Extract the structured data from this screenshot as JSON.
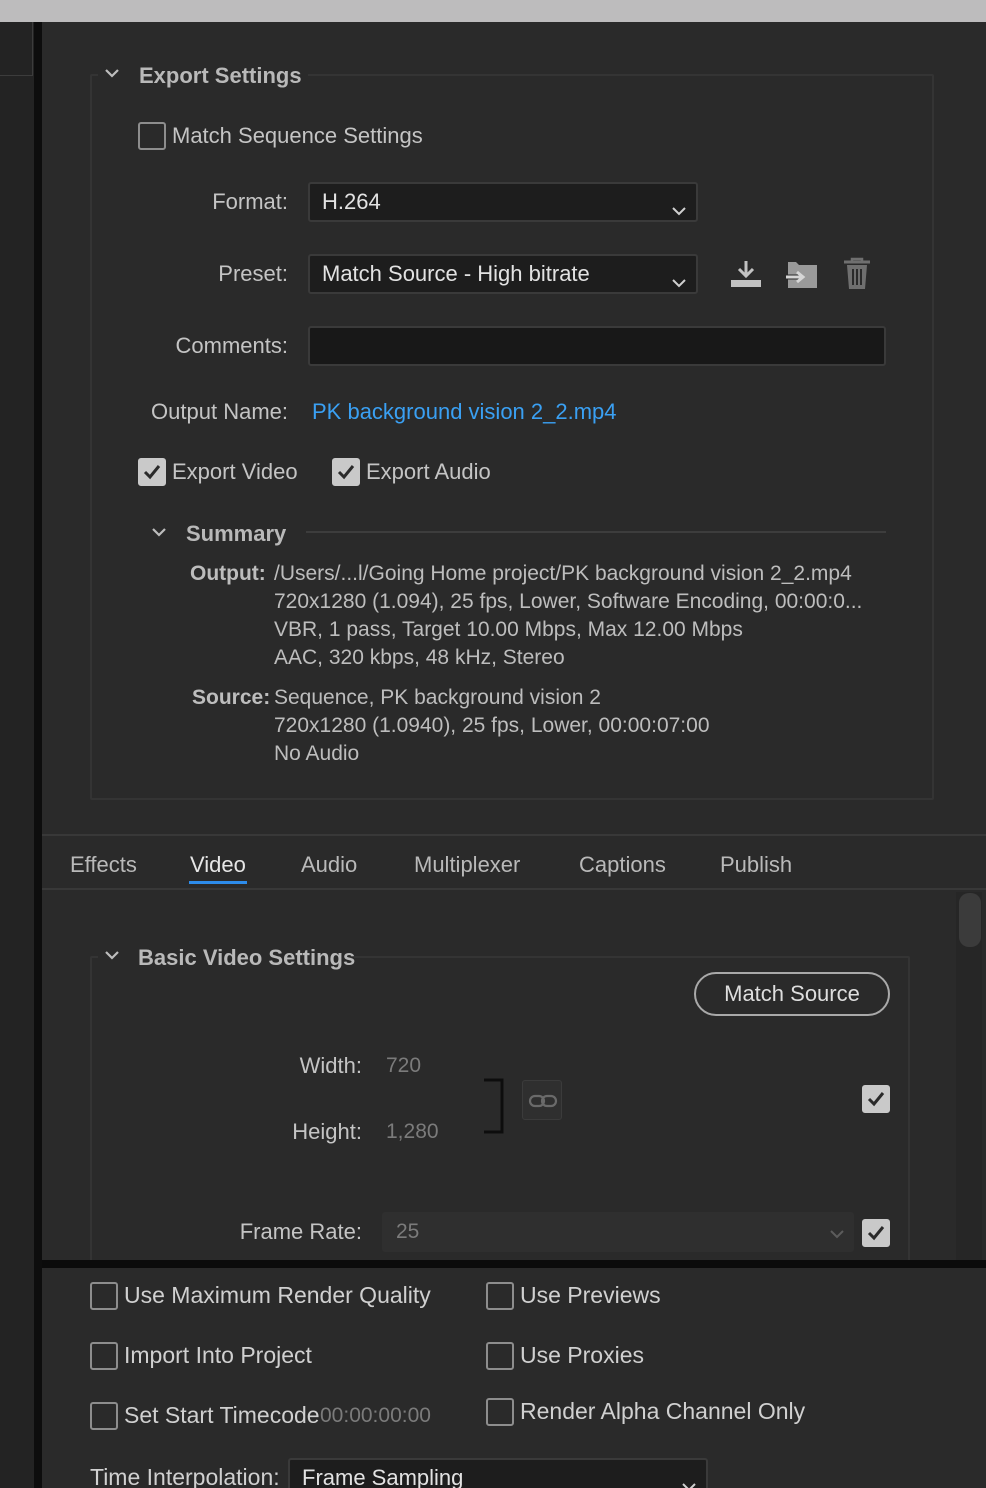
{
  "export_settings": {
    "title": "Export Settings",
    "match_sequence_label": "Match Sequence Settings",
    "match_sequence_checked": false,
    "format_label": "Format:",
    "format_value": "H.264",
    "preset_label": "Preset:",
    "preset_value": "Match Source - High bitrate",
    "comments_label": "Comments:",
    "comments_value": "",
    "output_name_label": "Output Name:",
    "output_name_value": "PK background vision 2_2.mp4",
    "export_video_label": "Export Video",
    "export_video_checked": true,
    "export_audio_label": "Export Audio",
    "export_audio_checked": true
  },
  "summary": {
    "title": "Summary",
    "output_key": "Output:",
    "output_lines": [
      "/Users/...l/Going Home project/PK background vision 2_2.mp4",
      "720x1280 (1.094), 25 fps, Lower, Software Encoding, 00:00:0...",
      "VBR, 1 pass, Target 10.00 Mbps, Max 12.00 Mbps",
      "AAC, 320 kbps, 48 kHz, Stereo"
    ],
    "source_key": "Source:",
    "source_lines": [
      "Sequence, PK background vision 2",
      "720x1280 (1.0940), 25 fps, Lower, 00:00:07:00",
      "No Audio"
    ]
  },
  "tabs": [
    {
      "label": "Effects",
      "active": false
    },
    {
      "label": "Video",
      "active": true
    },
    {
      "label": "Audio",
      "active": false
    },
    {
      "label": "Multiplexer",
      "active": false
    },
    {
      "label": "Captions",
      "active": false
    },
    {
      "label": "Publish",
      "active": false
    }
  ],
  "basic_video": {
    "title": "Basic Video Settings",
    "match_source_label": "Match Source",
    "width_label": "Width:",
    "width_value": "720",
    "height_label": "Height:",
    "height_value": "1,280",
    "size_checked": true,
    "frame_rate_label": "Frame Rate:",
    "frame_rate_value": "25",
    "frame_rate_checked": true
  },
  "render_options": {
    "max_quality_label": "Use Maximum Render Quality",
    "use_previews_label": "Use Previews",
    "import_project_label": "Import Into Project",
    "use_proxies_label": "Use Proxies",
    "set_start_tc_label": "Set Start Timecode",
    "start_tc_value": "00:00:00:00",
    "alpha_only_label": "Render Alpha Channel Only",
    "time_interp_label": "Time Interpolation:",
    "time_interp_value": "Frame Sampling"
  },
  "icons": {
    "save_preset": "download-icon",
    "import_preset": "import-icon",
    "delete_preset": "trash-icon",
    "link": "link-icon"
  },
  "colors": {
    "accent": "#2d8ceb",
    "link": "#3aa0f3",
    "panel_bg": "#2a2a2a"
  }
}
